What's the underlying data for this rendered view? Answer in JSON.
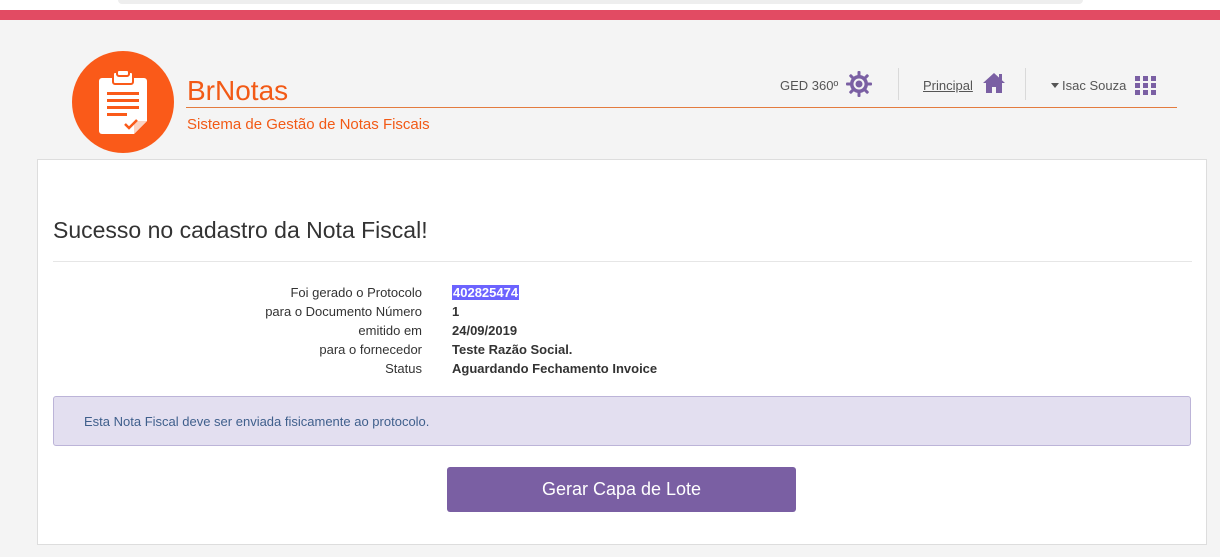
{
  "header": {
    "brand_title": "BrNotas",
    "brand_subtitle": "Sistema de Gestão de Notas Fiscais",
    "brand_color": "#f25a16",
    "topbar_color": "#e24b63",
    "nav": {
      "ged_label": "GED 360º",
      "principal_label": "Principal",
      "user_label": "Isac Souza"
    },
    "icons": {
      "logo": "clipboard-check-icon",
      "ged": "sun-settings-icon",
      "principal": "home-icon",
      "user_menu": "apps-grid-icon"
    }
  },
  "main": {
    "title": "Sucesso no cadastro da Nota Fiscal!",
    "details": [
      {
        "label": "Foi gerado o Protocolo",
        "value": "402825474"
      },
      {
        "label": "para o Documento Número",
        "value": "1"
      },
      {
        "label": "emitido em",
        "value": "24/09/2019"
      },
      {
        "label": "para o fornecedor",
        "value": "Teste Razão Social."
      },
      {
        "label": "Status",
        "value": "Aguardando Fechamento Invoice"
      }
    ],
    "alert_text": "Esta Nota Fiscal deve ser enviada fisicamente ao protocolo.",
    "button_label": "Gerar Capa de Lote",
    "button_color": "#7a5fa3"
  }
}
